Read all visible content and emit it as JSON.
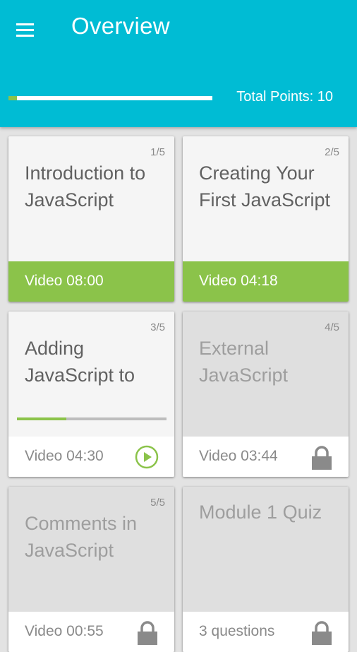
{
  "header": {
    "title": "Overview",
    "total_points": "Total Points: 10",
    "progress": 0.04
  },
  "colors": {
    "primary": "#00bcd4",
    "accent_green": "#8bc34a",
    "locked_card": "#dfdfdf"
  },
  "cards": [
    {
      "num": "1/5",
      "title": "Introduction to JavaScript",
      "footer": "Video 08:00",
      "state": "completed"
    },
    {
      "num": "2/5",
      "title": "Creating Your First JavaScript",
      "footer": "Video 04:18",
      "state": "completed"
    },
    {
      "num": "3/5",
      "title": "Adding JavaScript to",
      "footer": "Video 04:30",
      "state": "in-progress",
      "progress": 0.33,
      "icon": "play-circle-icon"
    },
    {
      "num": "4/5",
      "title": "External JavaScript",
      "footer": "Video 03:44",
      "state": "locked",
      "icon": "lock-icon"
    },
    {
      "num": "5/5",
      "title": "Comments in JavaScript",
      "footer": "Video 00:55",
      "state": "locked",
      "icon": "lock-icon"
    },
    {
      "num": "",
      "title": "Module 1 Quiz",
      "footer": "3 questions",
      "state": "locked",
      "icon": "lock-icon"
    }
  ]
}
